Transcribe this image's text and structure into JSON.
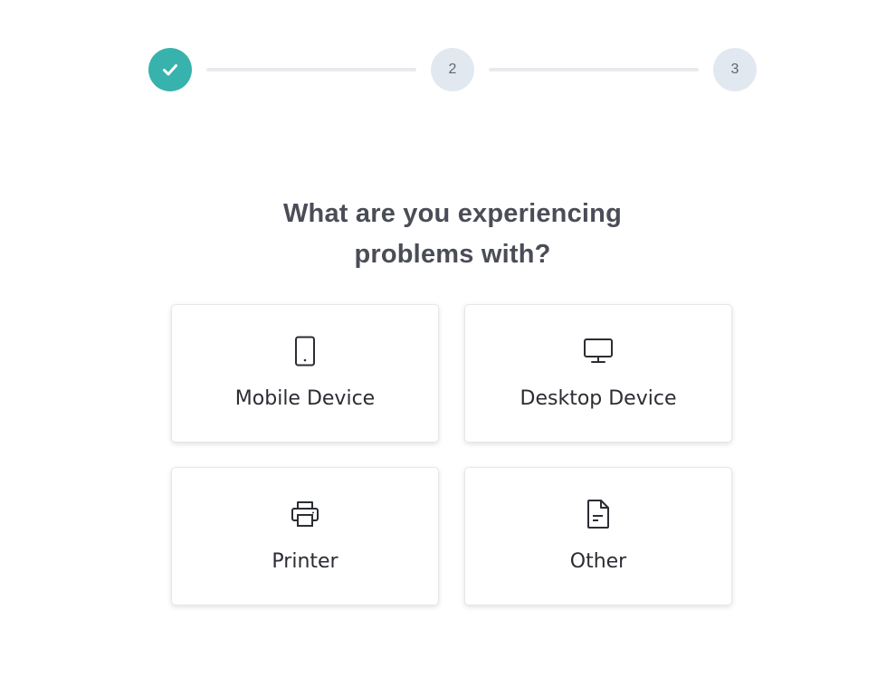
{
  "accent_color": "#38b2ac",
  "stepper": {
    "steps": [
      {
        "state": "complete",
        "icon": "check-icon",
        "label": ""
      },
      {
        "state": "pending",
        "label": "2"
      },
      {
        "state": "pending",
        "label": "3"
      }
    ]
  },
  "question": {
    "line1": "What are you experiencing",
    "line2": "problems with?"
  },
  "options": [
    {
      "label": "Mobile Device",
      "icon": "mobile-phone-icon"
    },
    {
      "label": "Desktop Device",
      "icon": "desktop-monitor-icon"
    },
    {
      "label": "Printer",
      "icon": "printer-icon"
    },
    {
      "label": "Other",
      "icon": "document-icon"
    }
  ]
}
